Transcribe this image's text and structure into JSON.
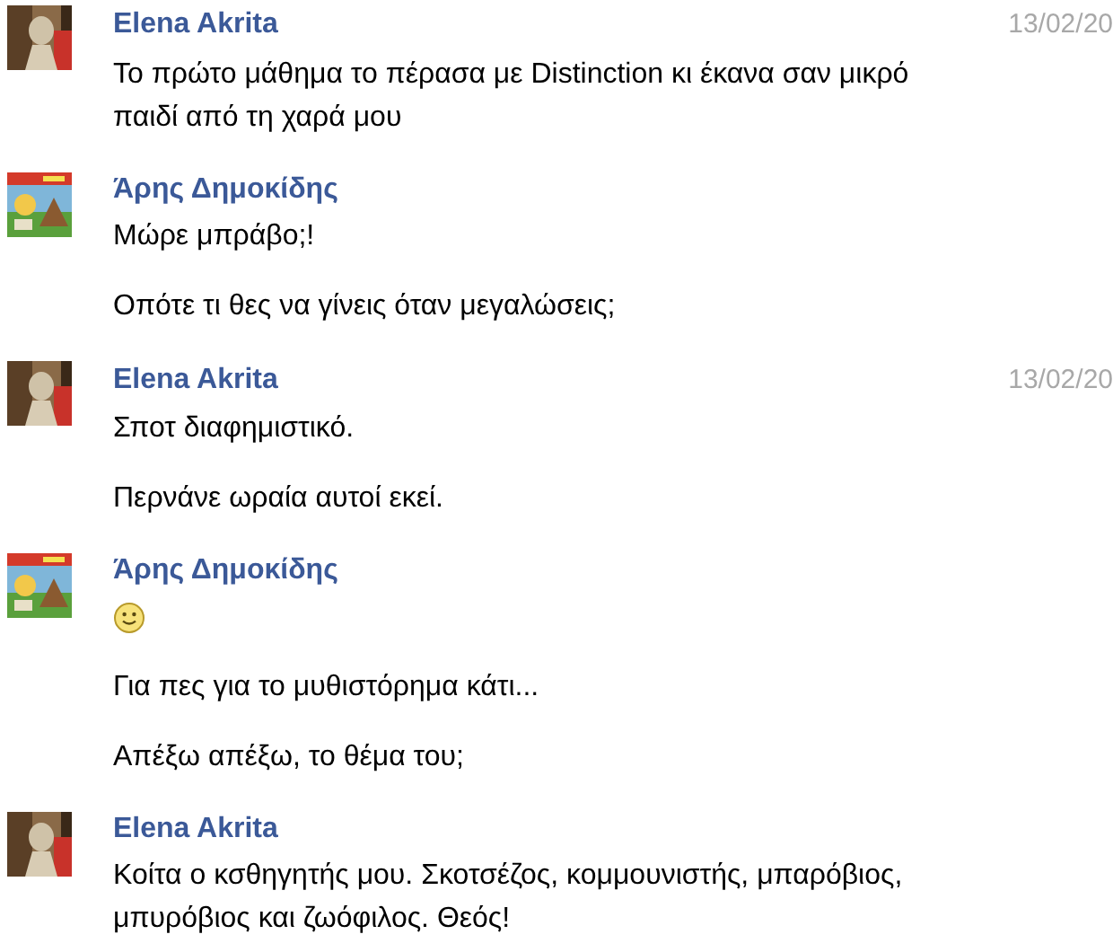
{
  "messages": [
    {
      "sender": "Elena Akrita",
      "date": "13/02/20",
      "avatar": {
        "kind": "picture"
      },
      "paragraphs": [
        {
          "kind": "text",
          "text": "Το πρώτο μάθημα το πέρασα με Distinction κι έκανα σαν μικρό παιδί από τη χαρά μου"
        }
      ]
    },
    {
      "sender": "Άρης Δημοκίδης",
      "avatar": {
        "kind": "picture"
      },
      "paragraphs": [
        {
          "kind": "text",
          "text": "Μώρε μπράβο;!"
        },
        {
          "kind": "text",
          "text": "Οπότε τι θες να γίνεις όταν μεγαλώσεις;"
        }
      ]
    },
    {
      "sender": "Elena Akrita",
      "date": "13/02/20",
      "avatar": {
        "kind": "picture"
      },
      "paragraphs": [
        {
          "kind": "text",
          "text": "Σποτ διαφημιστικό."
        },
        {
          "kind": "text",
          "text": "Περνάνε ωραία αυτοί εκεί."
        }
      ]
    },
    {
      "sender": "Άρης Δημοκίδης",
      "avatar": {
        "kind": "picture"
      },
      "paragraphs": [
        {
          "kind": "smiley"
        },
        {
          "kind": "text",
          "text": "Για πες για το μυθιστόρημα κάτι..."
        },
        {
          "kind": "text",
          "text": "Απέξω απέξω, το θέμα του;"
        }
      ]
    },
    {
      "sender": "Elena Akrita",
      "avatar": {
        "kind": "picture"
      },
      "paragraphs": [
        {
          "kind": "text",
          "text": "Κοίτα ο κσθηγητής μου. Σκοτσέζος, κομμουνιστής, μπαρόβιος, μπυρόβιος και ζωόφιλος. Θεός!"
        }
      ]
    }
  ]
}
